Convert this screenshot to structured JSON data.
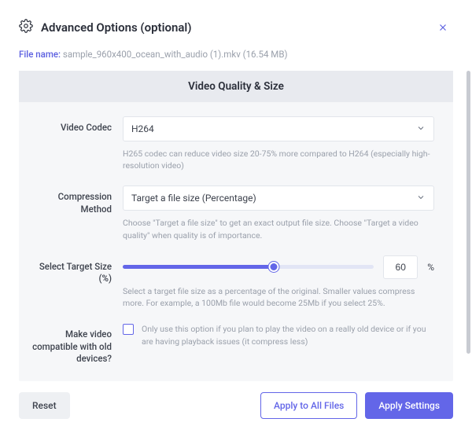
{
  "header": {
    "title": "Advanced Options (optional)"
  },
  "file": {
    "label": "File name:",
    "name": "sample_960x400_ocean_with_audio (1).mkv (16.54 MB)"
  },
  "panel": {
    "title": "Video Quality & Size"
  },
  "codec": {
    "label": "Video Codec",
    "value": "H264",
    "help": "H265 codec can reduce video size 20-75% more compared to H264 (especially high-resolution video)"
  },
  "compression": {
    "label": "Compression Method",
    "value": "Target a file size (Percentage)",
    "help": "Choose \"Target a file size\" to get an exact output file size. Choose \"Target a video quality\" when quality is of importance."
  },
  "target": {
    "label": "Select Target Size (%)",
    "value": "60",
    "percent_sign": "%",
    "slider_percent": 60,
    "help": "Select a target file size as a percentage of the original. Smaller values compress more. For example, a 100Mb file would become 25Mb if you select 25%."
  },
  "compat": {
    "label": "Make video compatible with old devices?",
    "checked": false,
    "help": "Only use this option if you plan to play the video on a really old device or if you are having playback issues (it compress less)"
  },
  "buttons": {
    "reset": "Reset",
    "apply_all": "Apply to All Files",
    "apply": "Apply Settings"
  }
}
